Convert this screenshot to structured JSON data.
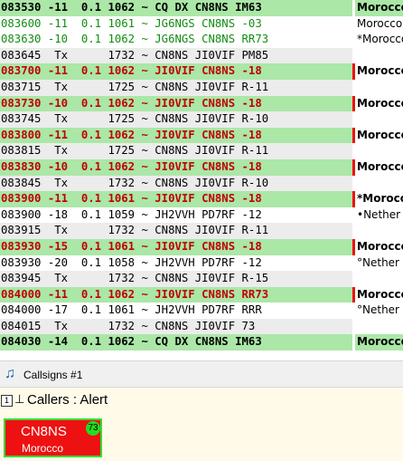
{
  "decode_log": [
    {
      "type": "cq",
      "message": "083530 -11  0.1 1062 ~ CQ DX CN8NS IM63",
      "country": "Morocco",
      "marker": ""
    },
    {
      "type": "other",
      "message": "083600 -11  0.1 1061 ~ JG6NGS CN8NS -03",
      "country": "Morocco",
      "marker": ""
    },
    {
      "type": "other",
      "message": "083630 -10  0.1 1062 ~ JG6NGS CN8NS RR73",
      "country": "Morocco",
      "marker": "*"
    },
    {
      "type": "tx",
      "message": "083645  Tx      1732 ~ CN8NS JI0VIF PM85",
      "country": "",
      "marker": ""
    },
    {
      "type": "reply",
      "message": "083700 -11  0.1 1062 ~ JI0VIF CN8NS -18",
      "country": "Morocco",
      "marker": ""
    },
    {
      "type": "tx",
      "message": "083715  Tx      1725 ~ CN8NS JI0VIF R-11",
      "country": "",
      "marker": ""
    },
    {
      "type": "reply",
      "message": "083730 -10  0.1 1062 ~ JI0VIF CN8NS -18",
      "country": "Morocco",
      "marker": ""
    },
    {
      "type": "tx",
      "message": "083745  Tx      1725 ~ CN8NS JI0VIF R-10",
      "country": "",
      "marker": ""
    },
    {
      "type": "reply",
      "message": "083800 -11  0.1 1062 ~ JI0VIF CN8NS -18",
      "country": "Morocco",
      "marker": ""
    },
    {
      "type": "tx",
      "message": "083815  Tx      1725 ~ CN8NS JI0VIF R-11",
      "country": "",
      "marker": ""
    },
    {
      "type": "reply",
      "message": "083830 -10  0.1 1062 ~ JI0VIF CN8NS -18",
      "country": "Morocco",
      "marker": ""
    },
    {
      "type": "tx",
      "message": "083845  Tx      1732 ~ CN8NS JI0VIF R-10",
      "country": "",
      "marker": ""
    },
    {
      "type": "reply",
      "message": "083900 -11  0.1 1061 ~ JI0VIF CN8NS -18",
      "country": "Morocco",
      "marker": "*"
    },
    {
      "type": "normal",
      "message": "083900 -18  0.1 1059 ~ JH2VVH PD7RF -12",
      "country": "Nether",
      "marker": "•"
    },
    {
      "type": "tx",
      "message": "083915  Tx      1732 ~ CN8NS JI0VIF R-11",
      "country": "",
      "marker": ""
    },
    {
      "type": "reply",
      "message": "083930 -15  0.1 1061 ~ JI0VIF CN8NS -18",
      "country": "Morocco",
      "marker": ""
    },
    {
      "type": "normal",
      "message": "083930 -20  0.1 1058 ~ JH2VVH PD7RF -12",
      "country": "Nether",
      "marker": "°"
    },
    {
      "type": "tx",
      "message": "083945  Tx      1732 ~ CN8NS JI0VIF R-15",
      "country": "",
      "marker": ""
    },
    {
      "type": "reply",
      "message": "084000 -11  0.1 1062 ~ JI0VIF CN8NS RR73",
      "country": "Morocco",
      "marker": ""
    },
    {
      "type": "normal",
      "message": "084000 -17  0.1 1061 ~ JH2VVH PD7RF RRR",
      "country": "Nether",
      "marker": "°"
    },
    {
      "type": "tx",
      "message": "084015  Tx      1732 ~ CN8NS JI0VIF 73",
      "country": "",
      "marker": ""
    },
    {
      "type": "cq",
      "message": "084030 -14  0.1 1062 ~ CQ DX CN8NS IM63",
      "country": "Morocco",
      "marker": ""
    }
  ],
  "callsigns_panel": {
    "icon": "music-note-icon",
    "title": "Callsigns #1"
  },
  "callers": {
    "pin_box_label": "1",
    "pin_icon": "pushpin-icon",
    "title": "Callers : Alert",
    "card": {
      "callsign": "CN8NS",
      "country": "Morocco",
      "badge": "73",
      "background_color": "#ee1111",
      "border_color": "#33dd33",
      "badge_color": "#22dd22"
    }
  },
  "colors": {
    "cq_background": "#abe7a7",
    "reply_text": "#c00000",
    "reply_marker": "#ee1010",
    "tx_background": "#ececec",
    "other_text": "#128d12"
  }
}
